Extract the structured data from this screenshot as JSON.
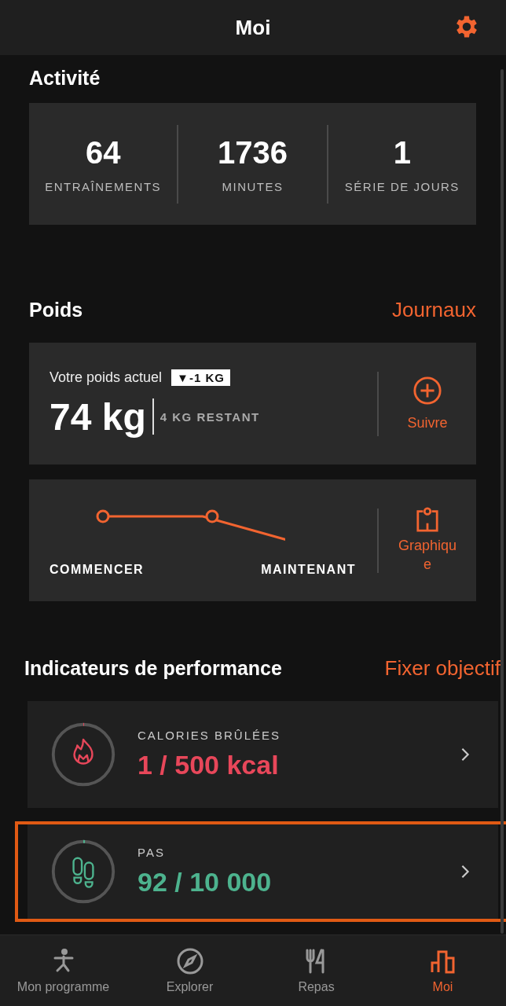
{
  "header": {
    "title": "Moi"
  },
  "activity": {
    "title": "Activité",
    "stats": [
      {
        "value": "64",
        "label": "ENTRAÎNEMENTS"
      },
      {
        "value": "1736",
        "label": "MINUTES"
      },
      {
        "value": "1",
        "label": "SÉRIE DE JOURS"
      }
    ]
  },
  "weight": {
    "title": "Poids",
    "link": "Journaux",
    "current_label": "Votre poids actuel",
    "change_badge": "▼-1 KG",
    "value": "74 kg",
    "remaining": "4 KG RESTANT",
    "track_button": "Suivre",
    "chart_start_label": "COMMENCER",
    "chart_end_label": "MAINTENANT",
    "chart_button": "Graphique"
  },
  "performance": {
    "title": "Indicateurs de performance",
    "link": "Fixer objectif",
    "indicators": [
      {
        "kind": "calories",
        "label": "CALORIES BRÛLÉES",
        "value": "1 / 500 kcal",
        "color": "#e8475a",
        "level": 0.002,
        "highlighted": false
      },
      {
        "kind": "steps",
        "label": "PAS",
        "value": "92 / 10 000",
        "color": "#4db38e",
        "level": 0.009,
        "highlighted": true
      }
    ]
  },
  "tab_bar": [
    {
      "kind": "program",
      "label": "Mon programme",
      "selected": false
    },
    {
      "kind": "explore",
      "label": "Explorer",
      "selected": false
    },
    {
      "kind": "meals",
      "label": "Repas",
      "selected": false
    },
    {
      "kind": "me",
      "label": "Moi",
      "selected": true
    }
  ]
}
